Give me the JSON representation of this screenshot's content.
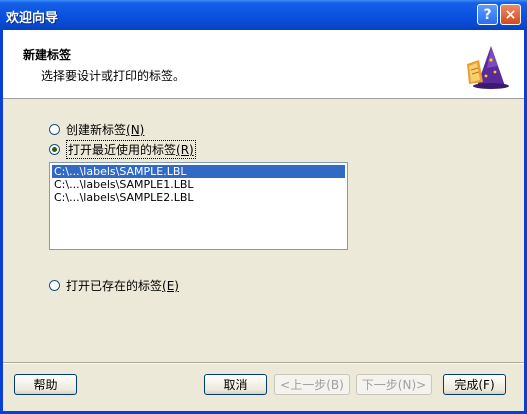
{
  "window": {
    "title": "欢迎向导",
    "help_button": "?",
    "close_button": "×"
  },
  "header": {
    "title": "新建标签",
    "subtitle": "选择要设计或打印的标签。",
    "icon": "wizard-hat-icon"
  },
  "options": {
    "create_new": {
      "text": "创建新标签",
      "key": "(N)",
      "checked": false
    },
    "open_recent": {
      "text": "打开最近使用的标签",
      "key": "(R)",
      "checked": true
    },
    "open_existing": {
      "text": "打开已存在的标签",
      "key": "(E)",
      "checked": false
    }
  },
  "recent_files": [
    {
      "path": "C:\\...\\labels\\SAMPLE.LBL",
      "selected": true
    },
    {
      "path": "C:\\...\\labels\\SAMPLE1.LBL",
      "selected": false
    },
    {
      "path": "C:\\...\\labels\\SAMPLE2.LBL",
      "selected": false
    }
  ],
  "buttons": {
    "help": "帮助",
    "cancel": "取消",
    "back": "<上一步(B)",
    "next": "下一步(N)>",
    "finish": "完成(F)"
  }
}
